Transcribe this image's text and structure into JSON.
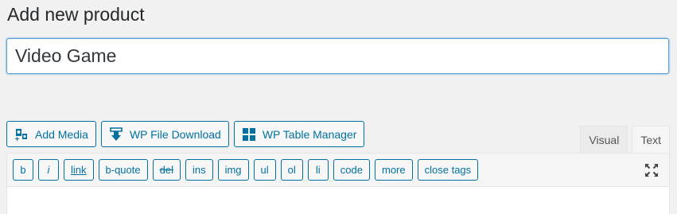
{
  "page": {
    "title": "Add new product"
  },
  "title_field": {
    "value": "Video Game"
  },
  "media_buttons": [
    {
      "label": "Add Media",
      "icon": "add-media-icon"
    },
    {
      "label": "WP File Download",
      "icon": "download-icon"
    },
    {
      "label": "WP Table Manager",
      "icon": "table-grid-icon"
    }
  ],
  "editor_tabs": {
    "visual": "Visual",
    "text": "Text",
    "active": "text"
  },
  "quicktags": [
    {
      "label": "b"
    },
    {
      "label": "i"
    },
    {
      "label": "link"
    },
    {
      "label": "b-quote"
    },
    {
      "label": "del"
    },
    {
      "label": "ins"
    },
    {
      "label": "img"
    },
    {
      "label": "ul"
    },
    {
      "label": "ol"
    },
    {
      "label": "li"
    },
    {
      "label": "code"
    },
    {
      "label": "more"
    },
    {
      "label": "close tags"
    }
  ],
  "fullscreen_icon": "fullscreen-icon",
  "colors": {
    "accent": "#0071a1",
    "focus_border": "#5b9dd9",
    "background": "#f1f1f1"
  }
}
